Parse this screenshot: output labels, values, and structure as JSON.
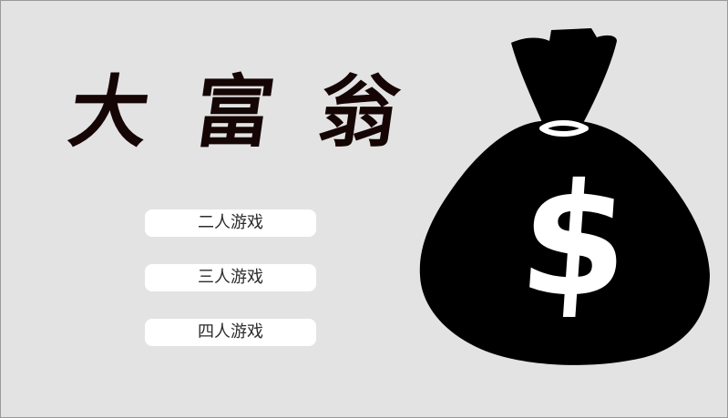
{
  "title": {
    "chars": [
      "大",
      "富",
      "翁"
    ]
  },
  "menu": {
    "two_players": "二人游戏",
    "three_players": "三人游戏",
    "four_players": "四人游戏"
  },
  "decoration": {
    "icon": "money-bag-icon",
    "symbol": "$"
  },
  "colors": {
    "background": "#e3e3e3",
    "button": "#ffffff",
    "title_ink": "#150605"
  }
}
